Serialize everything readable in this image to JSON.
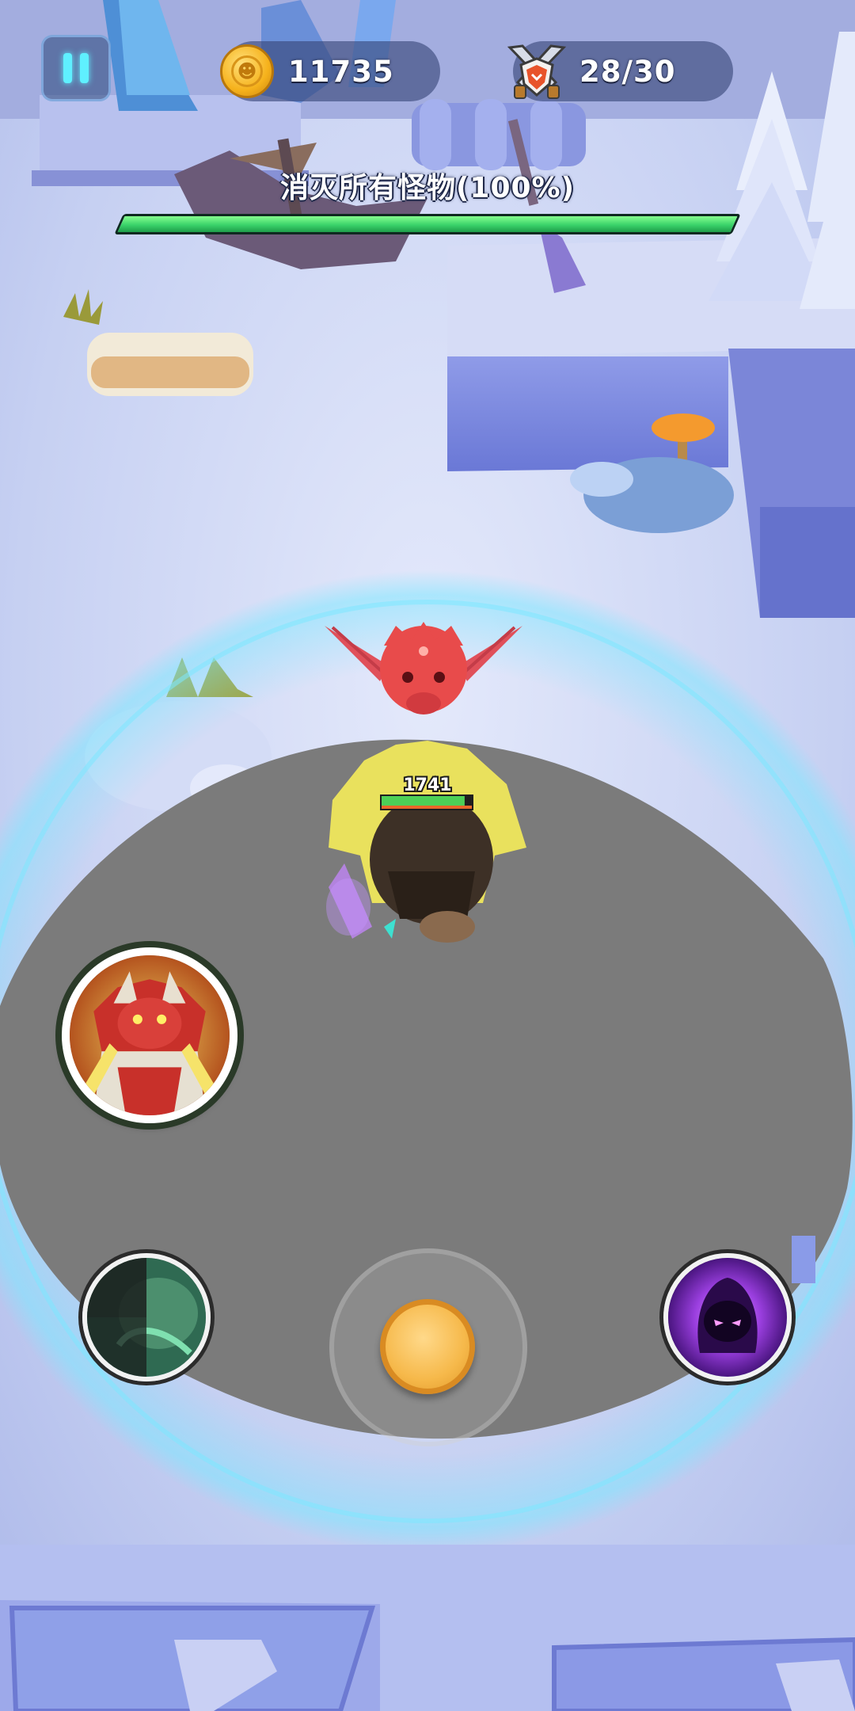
{
  "hud": {
    "pause_icon": "pause-icon",
    "coins": "11735",
    "coin_icon": "skull-coin-icon",
    "energy": "28/30",
    "energy_icon": "crossed-swords-shield-icon"
  },
  "objective": {
    "text": "消灭所有怪物(100%)",
    "progress": 1.0,
    "bar_color": "#3bd36a"
  },
  "player": {
    "hp_value": "1741",
    "hp_fraction": 0.92,
    "hp_bar_color": "#4ccf57",
    "secondary_bar_color": "#e8672a"
  },
  "enemy": {
    "name_icon": "red-winged-imp",
    "color": "#e84b4b"
  },
  "controls": {
    "hero_skill_icon": "red-armored-hero-portrait",
    "nature_skill_icon": "green-spirit-skill-icon",
    "shadow_skill_icon": "purple-hooded-shadow-icon",
    "joystick_icon": "virtual-joystick"
  },
  "colors": {
    "snow": "#c9d3f3",
    "arena": "#7b7b7b",
    "arena_ring": "#7ee7ff"
  }
}
